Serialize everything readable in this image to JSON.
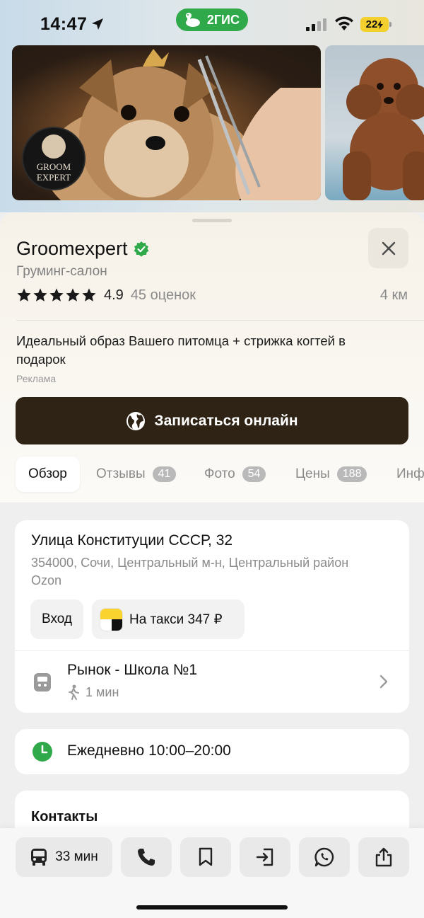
{
  "status_bar": {
    "time": "14:47",
    "brand": "2ГИС",
    "battery": "22"
  },
  "gallery": {
    "logo_line1": "GROOM",
    "logo_line2": "EXPERT"
  },
  "place": {
    "name": "Groomexpert",
    "category": "Груминг-салон",
    "rating": "4.9",
    "reviews": "45 оценок",
    "distance": "4 км",
    "stars_filled": 5,
    "ad_text": "Идеальный образ Вашего питомца + стрижка когтей в подарок",
    "ad_label": "Реклама",
    "cta_label": "Записаться онлайн"
  },
  "tabs": [
    {
      "label": "Обзор",
      "badge": ""
    },
    {
      "label": "Отзывы",
      "badge": "41"
    },
    {
      "label": "Фото",
      "badge": "54"
    },
    {
      "label": "Цены",
      "badge": "188"
    },
    {
      "label": "Инф",
      "badge": ""
    }
  ],
  "address": {
    "street": "Улица Конституции СССР, 32",
    "details": "354000, Сочи, Центральный м-н, Центральный район",
    "extra": "Ozon",
    "entry_label": "Вход",
    "taxi_label": "На такси 347 ₽"
  },
  "transit": {
    "stop": "Рынок - Школа №1",
    "walk": "1 мин"
  },
  "hours": {
    "text": "Ежедневно 10:00–20:00"
  },
  "contacts": {
    "title": "Контакты"
  },
  "bottom_bar": {
    "route_time": "33 мин"
  },
  "colors": {
    "accent_green": "#2fa94a",
    "cta_bg": "#2e2315",
    "taxi_yellow": "#fbd32e"
  }
}
